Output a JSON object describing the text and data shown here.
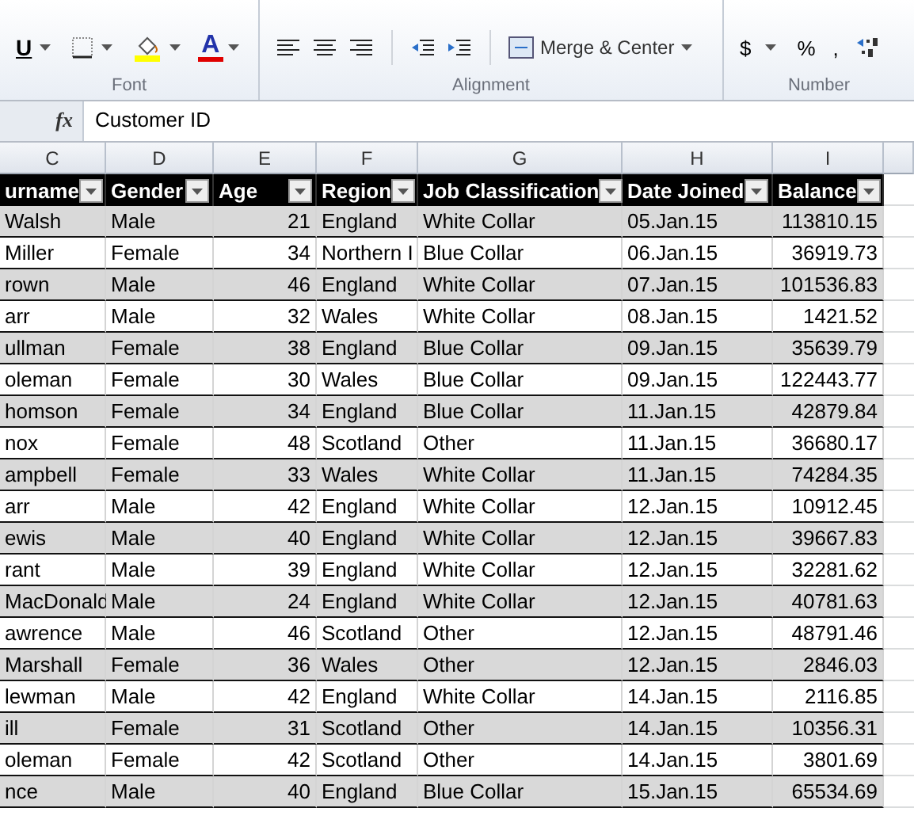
{
  "ribbon": {
    "font_group": {
      "label": "Font",
      "tools": [
        {
          "kind": "underline",
          "text": "U"
        },
        {
          "kind": "borders"
        },
        {
          "kind": "fill"
        },
        {
          "kind": "fontcolor",
          "text": "A"
        }
      ]
    },
    "alignment_group": {
      "label": "Alignment",
      "merge_button": "Merge & Center"
    },
    "number_group": {
      "label": "Number",
      "currency": "$",
      "percent": "%",
      "comma": ","
    }
  },
  "formula_bar": {
    "function_label": "fx",
    "value": "Customer ID"
  },
  "column_letters": [
    "C",
    "D",
    "E",
    "F",
    "G",
    "H",
    "I"
  ],
  "table": {
    "columns": [
      {
        "label": "urname",
        "kind": "text"
      },
      {
        "label": "Gender",
        "kind": "text"
      },
      {
        "label": "Age",
        "kind": "number"
      },
      {
        "label": "Region",
        "kind": "text"
      },
      {
        "label": "Job Classification",
        "kind": "text"
      },
      {
        "label": "Date Joined",
        "kind": "text"
      },
      {
        "label": "Balance",
        "kind": "number"
      }
    ],
    "rows": [
      [
        "Walsh",
        "Male",
        "21",
        "England",
        "White Collar",
        "05.Jan.15",
        "113810.15"
      ],
      [
        "Miller",
        "Female",
        "34",
        "Northern I",
        "Blue Collar",
        "06.Jan.15",
        "36919.73"
      ],
      [
        "rown",
        "Male",
        "46",
        "England",
        "White Collar",
        "07.Jan.15",
        "101536.83"
      ],
      [
        "arr",
        "Male",
        "32",
        "Wales",
        "White Collar",
        "08.Jan.15",
        "1421.52"
      ],
      [
        "ullman",
        "Female",
        "38",
        "England",
        "Blue Collar",
        "09.Jan.15",
        "35639.79"
      ],
      [
        "oleman",
        "Female",
        "30",
        "Wales",
        "Blue Collar",
        "09.Jan.15",
        "122443.77"
      ],
      [
        "homson",
        "Female",
        "34",
        "England",
        "Blue Collar",
        "11.Jan.15",
        "42879.84"
      ],
      [
        "nox",
        "Female",
        "48",
        "Scotland",
        "Other",
        "11.Jan.15",
        "36680.17"
      ],
      [
        "ampbell",
        "Female",
        "33",
        "Wales",
        "White Collar",
        "11.Jan.15",
        "74284.35"
      ],
      [
        "arr",
        "Male",
        "42",
        "England",
        "White Collar",
        "12.Jan.15",
        "10912.45"
      ],
      [
        "ewis",
        "Male",
        "40",
        "England",
        "White Collar",
        "12.Jan.15",
        "39667.83"
      ],
      [
        "rant",
        "Male",
        "39",
        "England",
        "White Collar",
        "12.Jan.15",
        "32281.62"
      ],
      [
        "MacDonald",
        "Male",
        "24",
        "England",
        "White Collar",
        "12.Jan.15",
        "40781.63"
      ],
      [
        "awrence",
        "Male",
        "46",
        "Scotland",
        "Other",
        "12.Jan.15",
        "48791.46"
      ],
      [
        "Marshall",
        "Female",
        "36",
        "Wales",
        "Other",
        "12.Jan.15",
        "2846.03"
      ],
      [
        "lewman",
        "Male",
        "42",
        "England",
        "White Collar",
        "14.Jan.15",
        "2116.85"
      ],
      [
        "ill",
        "Female",
        "31",
        "Scotland",
        "Other",
        "14.Jan.15",
        "10356.31"
      ],
      [
        "oleman",
        "Female",
        "42",
        "Scotland",
        "Other",
        "14.Jan.15",
        "3801.69"
      ],
      [
        "nce",
        "Male",
        "40",
        "England",
        "Blue Collar",
        "15.Jan.15",
        "65534.69"
      ]
    ]
  }
}
